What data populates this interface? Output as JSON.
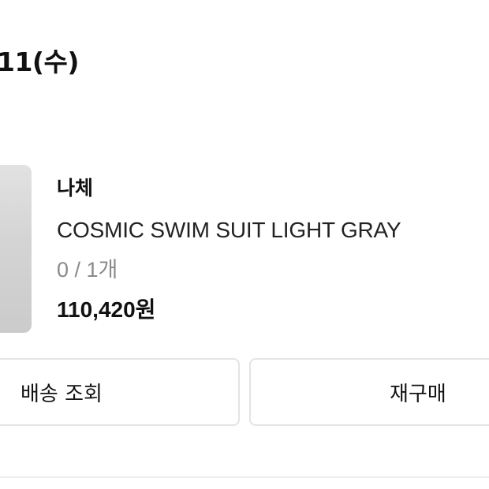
{
  "order": {
    "date_text": "11(수)"
  },
  "product": {
    "brand": "나체",
    "name": "COSMIC SWIM SUIT LIGHT GRAY",
    "quantity": "0 / 1개",
    "price": "110,420원",
    "thumbnail_color": "#d6d6d6"
  },
  "actions": {
    "track_label": "배송 조회",
    "reorder_label": "재구매"
  }
}
